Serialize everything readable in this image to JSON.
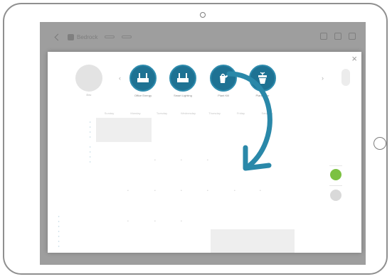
{
  "app_bar": {
    "app_name": "Bedrock"
  },
  "dialog": {
    "close_label": "×",
    "avatar_label": "Eric",
    "nav_prev": "‹",
    "nav_next": "›",
    "tiles": [
      {
        "label": "Office Energy",
        "icon": "router-icon"
      },
      {
        "label": "Smart Lighting",
        "icon": "router-icon"
      },
      {
        "label": "Plant Kill",
        "icon": "watering-can-icon"
      },
      {
        "label": "Plant Care",
        "icon": "flower-pot-icon"
      }
    ],
    "weekdays": [
      "Sunday",
      "Monday",
      "Tuesday",
      "Wednesday",
      "Thursday",
      "Friday",
      "Saturday"
    ]
  },
  "colors": {
    "tile_fill": "#1e7293",
    "arrow": "#2a88a9",
    "accent_green": "#7cc142"
  }
}
